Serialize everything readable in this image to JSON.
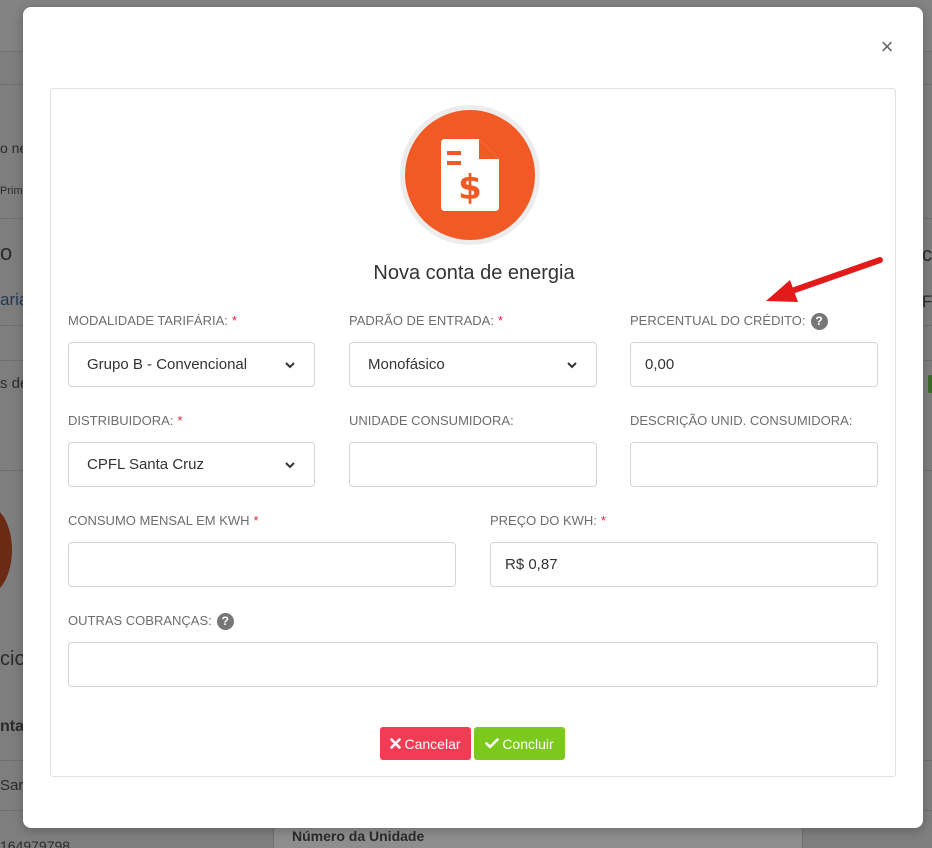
{
  "background": {
    "fragments": [
      "o ne",
      "Prime",
      "o",
      "aria",
      "s de",
      "cio",
      "nta",
      "Sar",
      "164979798",
      "Número da Unidade",
      "c",
      "F"
    ]
  },
  "modal": {
    "title": "Nova conta de energia",
    "close_symbol": "×",
    "icon": "invoice-dollar-icon",
    "accent_color": "#f15a24",
    "fields": {
      "modalidade": {
        "label": "MODALIDADE TARIFÁRIA:",
        "required": "*",
        "value": "Grupo B - Convencional"
      },
      "padrao": {
        "label": "PADRÃO DE ENTRADA:",
        "required": "*",
        "value": "Monofásico"
      },
      "percentual": {
        "label": "PERCENTUAL DO CRÉDITO:",
        "value": "0,00",
        "help": "?"
      },
      "distribuidora": {
        "label": "DISTRIBUIDORA:",
        "required": "*",
        "value": "CPFL Santa Cruz"
      },
      "unidade": {
        "label": "UNIDADE CONSUMIDORA:",
        "value": ""
      },
      "descricao": {
        "label": "DESCRIÇÃO UNID. CONSUMIDORA:",
        "value": ""
      },
      "consumo": {
        "label": "CONSUMO MENSAL EM KWH",
        "required": "*",
        "value": ""
      },
      "preco": {
        "label": "PREÇO DO KWH:",
        "required": "*",
        "value": "R$ 0,87"
      },
      "outras": {
        "label": "OUTRAS COBRANÇAS:",
        "value": "",
        "help": "?"
      }
    },
    "buttons": {
      "cancel": "Cancelar",
      "confirm": "Concluir",
      "cancel_color": "#f23c56",
      "confirm_color": "#7ac91c"
    }
  },
  "annotation": {
    "type": "red-arrow",
    "color": "#e31a1a"
  }
}
